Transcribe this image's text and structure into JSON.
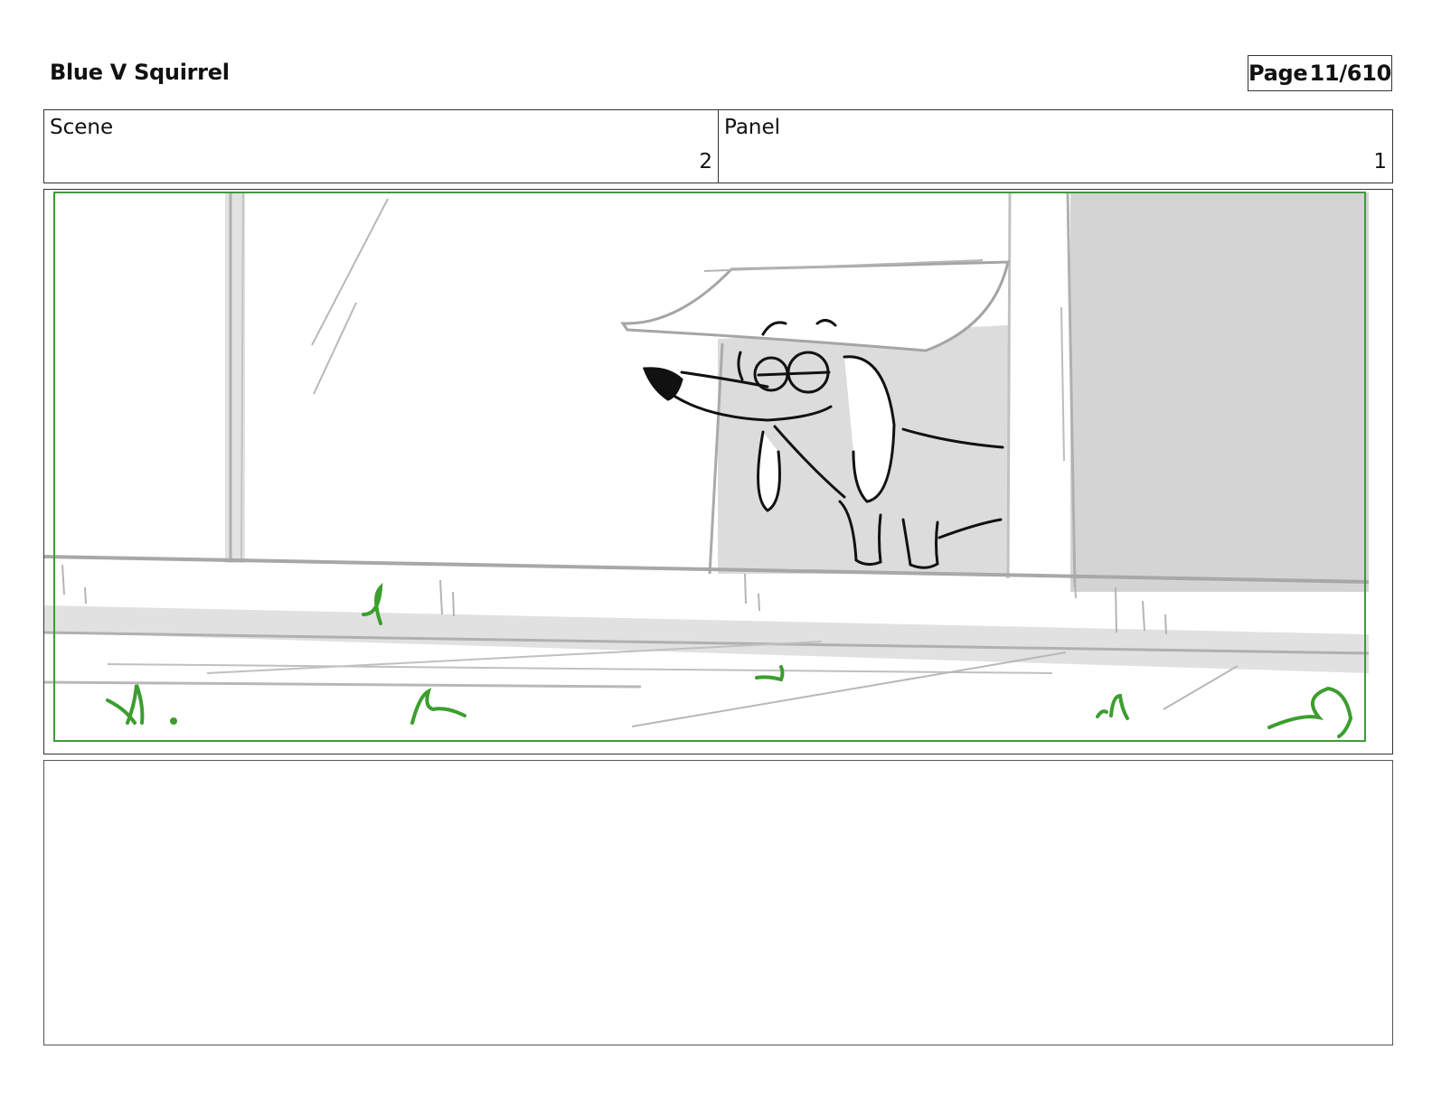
{
  "header": {
    "project_title": "Blue V Squirrel",
    "page_label": "Page",
    "page_number": "11/610"
  },
  "info": {
    "scene_label": "Scene",
    "scene_value": "2",
    "panel_label": "Panel",
    "panel_value": "1"
  },
  "frame": {
    "safe_area_color": "#3f9a3a",
    "grass_color": "#3c9e2e",
    "sketch_gray": "#b5b5b5",
    "shadow_gray": "#d9d9d9",
    "ink_color": "#111111"
  },
  "notes": {
    "text": ""
  }
}
